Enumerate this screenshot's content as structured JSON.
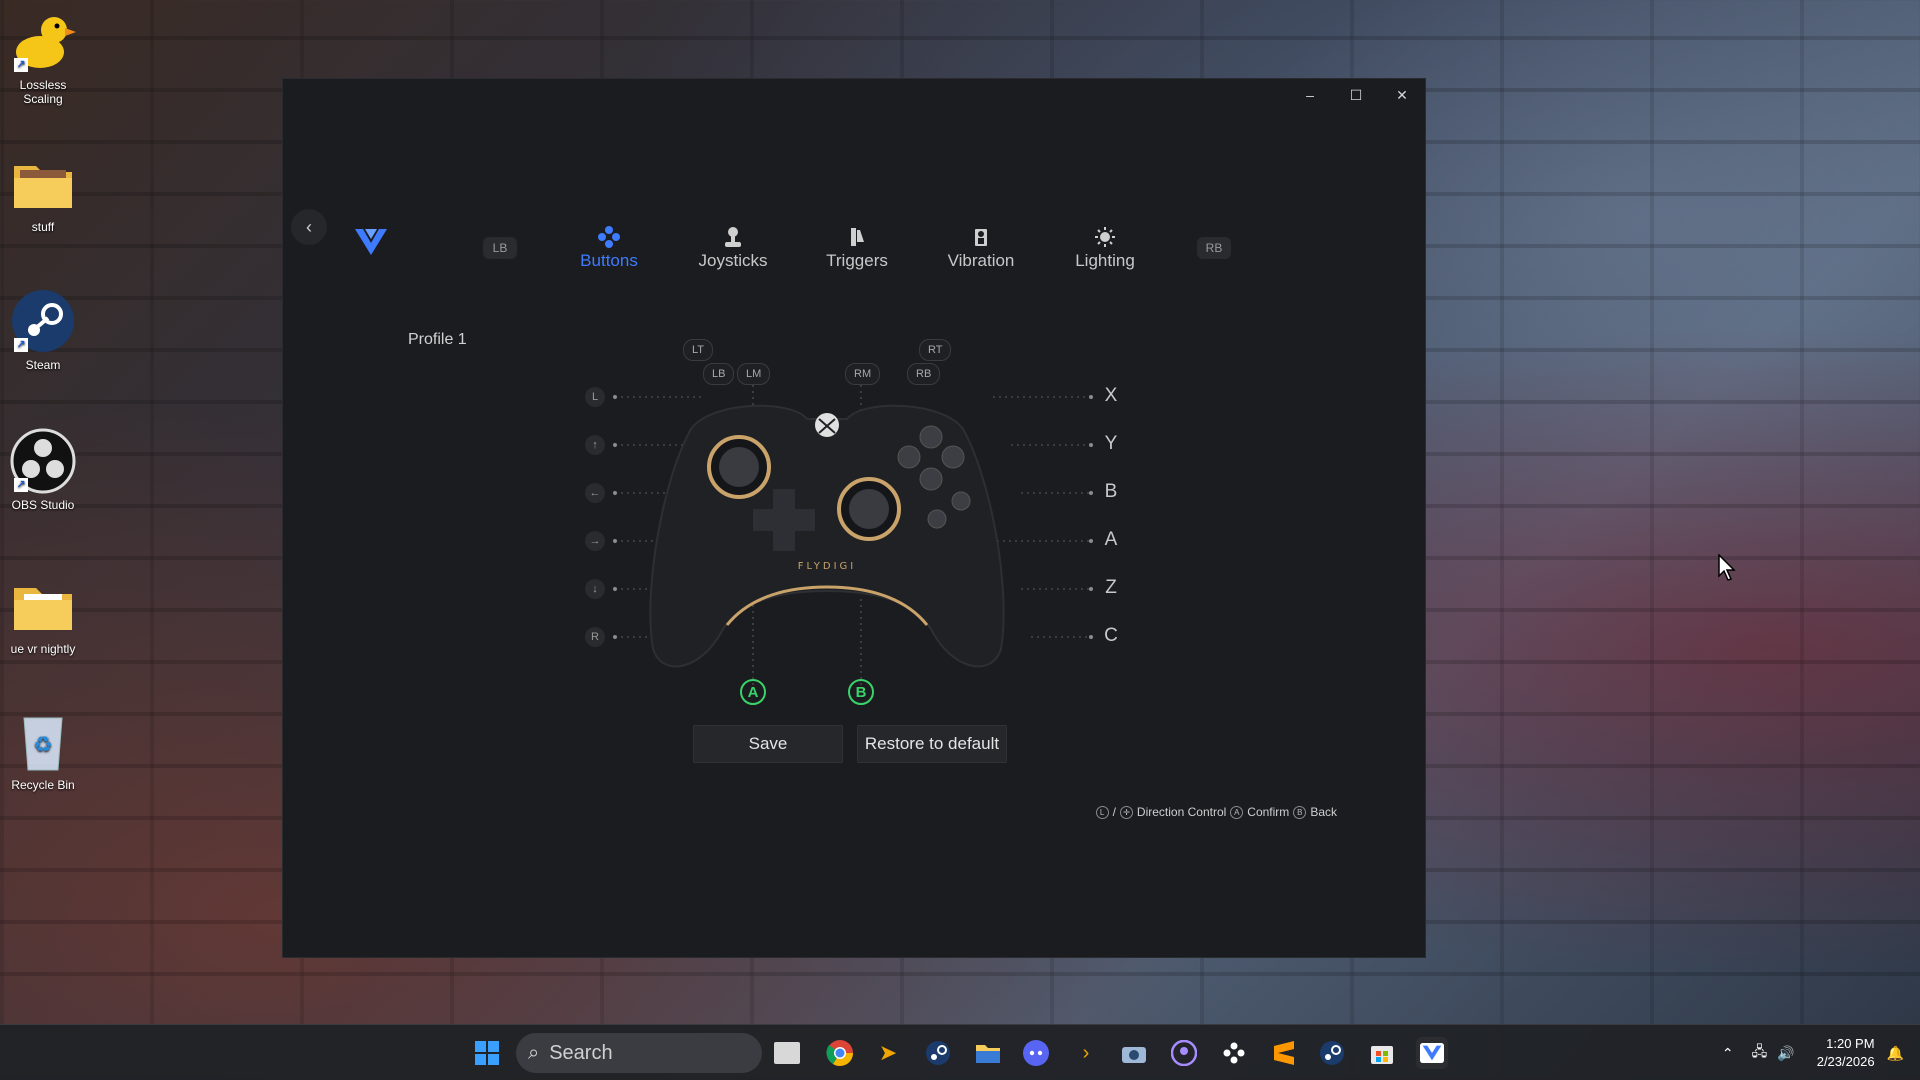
{
  "desktop": {
    "icons": [
      {
        "label": "Lossless Scaling",
        "icon": "duck-icon"
      },
      {
        "label": "stuff",
        "icon": "folder-icon"
      },
      {
        "label": "Steam",
        "icon": "steam-icon"
      },
      {
        "label": "OBS Studio",
        "icon": "obs-icon"
      },
      {
        "label": "ue vr nightly",
        "icon": "folder-icon"
      },
      {
        "label": "Recycle Bin",
        "icon": "recycle-bin-icon"
      }
    ]
  },
  "window": {
    "caption": {
      "minimize": "–",
      "maximize": "☐",
      "close": "✕"
    },
    "nav": {
      "left_bumper": "LB",
      "right_bumper": "RB",
      "tabs": [
        {
          "label": "Buttons",
          "icon": "gamepad-buttons-icon",
          "active": true
        },
        {
          "label": "Joysticks",
          "icon": "joystick-icon",
          "active": false
        },
        {
          "label": "Triggers",
          "icon": "trigger-icon",
          "active": false
        },
        {
          "label": "Vibration",
          "icon": "vibration-icon",
          "active": false
        },
        {
          "label": "Lighting",
          "icon": "lighting-icon",
          "active": false
        }
      ]
    },
    "profile": "Profile 1",
    "controller": {
      "brand_text": "FLYDIGI",
      "top_labels": [
        "LT",
        "LB",
        "LM",
        "RM",
        "RB",
        "RT"
      ],
      "left_labels": [
        "L",
        "↑",
        "←",
        "→",
        "↓",
        "R"
      ],
      "right_labels": [
        "X",
        "Y",
        "B",
        "A",
        "Z",
        "C"
      ],
      "bottom_labels": [
        "A",
        "B"
      ]
    },
    "actions": {
      "save": "Save",
      "restore": "Restore to default"
    },
    "hints": {
      "sep": "/",
      "direction": "Direction Control",
      "confirm_key": "A",
      "confirm": "Confirm",
      "back_key": "B",
      "back": "Back"
    },
    "colors": {
      "accent": "#3e7bff",
      "extra_button": "#39d36a",
      "gold": "#c9a36a"
    }
  },
  "taskbar": {
    "search_placeholder": "Search",
    "icons": [
      "windows-start-icon",
      "task-view-icon",
      "chrome-icon",
      "plex-icon",
      "steam-icon",
      "file-explorer-icon",
      "discord-icon",
      "terminal-icon",
      "camera-icon",
      "app-icon",
      "flydigi-space-icon",
      "sublime-icon",
      "steam-icon",
      "store-icon",
      "flydigi-icon"
    ],
    "clock": {
      "time": "1:20 PM",
      "date": "2/23/2026"
    }
  }
}
